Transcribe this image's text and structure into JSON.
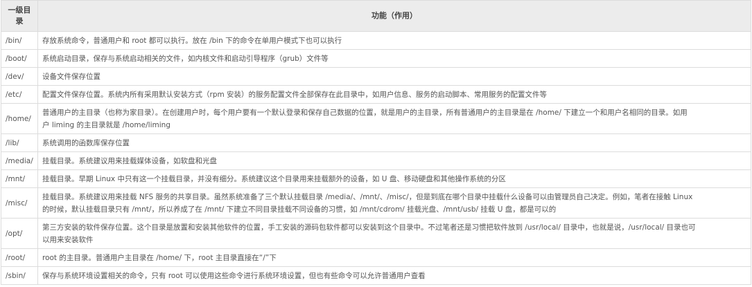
{
  "table": {
    "headers": [
      "一级目录",
      "功能（作用）"
    ],
    "rows": [
      {
        "dir": "/bin/",
        "lines": [
          "存放系统命令，普通用户和 root 都可以执行。放在 /bin 下的命令在单用户模式下也可以执行"
        ]
      },
      {
        "dir": "/boot/",
        "lines": [
          "系统启动目录，保存与系统启动相关的文件，如内核文件和启动引导程序（grub）文件等"
        ]
      },
      {
        "dir": "/dev/",
        "lines": [
          "设备文件保存位置"
        ]
      },
      {
        "dir": "/etc/",
        "lines": [
          "配置文件保存位置。系统内所有采用默认安装方式（rpm 安装）的服务配置文件全部保存在此目录中，如用户信息、服务的启动脚本、常用服务的配置文件等"
        ]
      },
      {
        "dir": "/home/",
        "lines": [
          "普通用户的主目录（也称为家目录）。在创建用户时，每个用户要有一个默认登录和保存自己数据的位置，就是用户的主目录，所有普通用户的主目录是在 /home/ 下建立一个和用户名相同的目录。如用",
          "户 liming 的主目录就是 /home/liming"
        ]
      },
      {
        "dir": "/lib/",
        "lines": [
          "系统调用的函数库保存位置"
        ]
      },
      {
        "dir": "/media/",
        "lines": [
          "挂载目录。系统建议用来挂载媒体设备，如软盘和光盘"
        ]
      },
      {
        "dir": "/mnt/",
        "lines": [
          "挂载目录。早期 Linux 中只有这一个挂载目录，并没有细分。系统建议这个目录用来挂载额外的设备，如 U 盘、移动硬盘和其他操作系统的分区"
        ]
      },
      {
        "dir": "/misc/",
        "lines": [
          "挂载目录。系统建议用来挂载 NFS 服务的共享目录。虽然系统准备了三个默认挂载目录 /media/、/mnt/、/misc/，但是到底在哪个目录中挂载什么设备可以由管理员自己决定。例如，笔者在接触 Linux",
          "的时候，默认挂载目录只有 /mnt/，所以养成了在 /mnt/ 下建立不同目录挂载不同设备的习惯，如 /mnt/cdrom/ 挂载光盘、/mnt/usb/ 挂载 U 盘，都是可以的"
        ]
      },
      {
        "dir": "/opt/",
        "lines": [
          "第三方安装的软件保存位置。这个目录是放置和安装其他软件的位置，手工安装的源码包软件都可以安装到这个目录中。不过笔者还是习惯把软件放到 /usr/local/ 目录中，也就是说，/usr/local/ 目录也可",
          "以用来安装软件"
        ]
      },
      {
        "dir": "/root/",
        "lines": [
          "root 的主目录。普通用户主目录在 /home/ 下，root 主目录直接在“/”下"
        ]
      },
      {
        "dir": "/sbin/",
        "lines": [
          "保存与系统环境设置相关的命令，只有 root 可以使用这些命令进行系统环境设置，但也有些命令可以允许普通用户查看"
        ]
      }
    ]
  }
}
